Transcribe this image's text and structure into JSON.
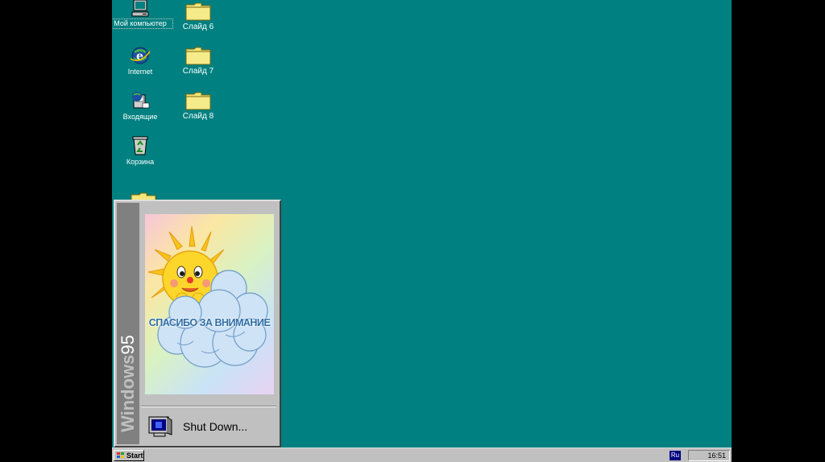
{
  "desktop": {
    "background": "#008080",
    "icons": [
      {
        "label": "Мой компьютер",
        "icon": "my-computer-icon"
      },
      {
        "label": "Internet",
        "icon": "internet-explorer-icon"
      },
      {
        "label": "Входящие",
        "icon": "inbox-icon"
      },
      {
        "label": "Корзина",
        "icon": "recycle-bin-icon"
      }
    ],
    "folders": [
      {
        "label": "Слайд 6",
        "icon": "folder-icon"
      },
      {
        "label": "Слайд 7",
        "icon": "folder-icon"
      },
      {
        "label": "Слайд 8",
        "icon": "folder-icon"
      }
    ]
  },
  "start_menu": {
    "banner_bold": "Windows",
    "banner_version": "95",
    "picture_caption": "СПАСИБО ЗА ВНИМАНИЕ",
    "picture_icon": "sun-on-cloud-picture",
    "shutdown_label": "Shut Down...",
    "shutdown_icon": "shutdown-computer-icon"
  },
  "taskbar": {
    "start_label": "Start",
    "start_icon": "windows-logo-icon",
    "language": "Ru",
    "clock": "16:51"
  }
}
